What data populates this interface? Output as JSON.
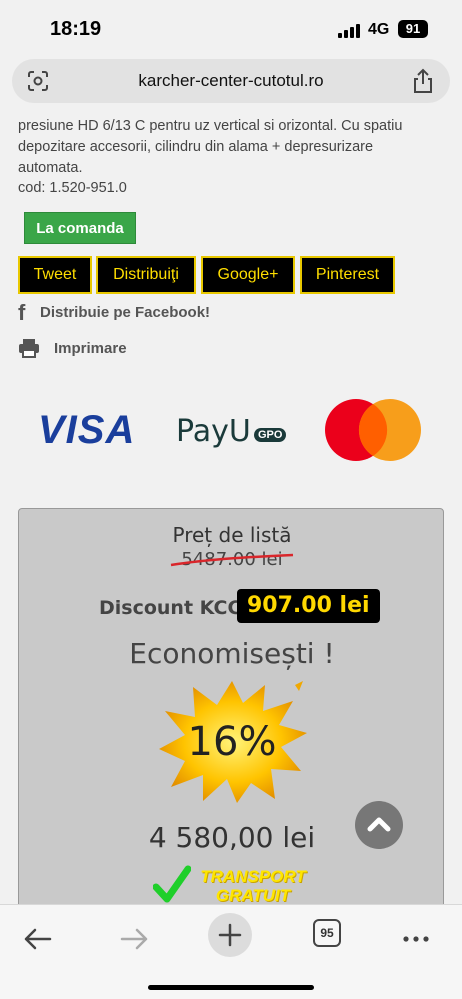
{
  "status": {
    "time": "18:19",
    "network": "4G",
    "battery": "91"
  },
  "browser": {
    "url": "karcher-center-cutotul.ro"
  },
  "product": {
    "description": "presiune HD 6/13 C pentru uz vertical si orizontal. Cu spatiu depozitare accesorii, cilindru din alama + depresurizare automata.",
    "code": "cod: 1.520-951.0",
    "order_label": "La comanda"
  },
  "share": {
    "tweet": "Tweet",
    "distribute": "Distribuiţi",
    "google": "Google+",
    "pinterest": "Pinterest",
    "facebook": "Distribuie pe Facebook!",
    "print": "Imprimare"
  },
  "payments": {
    "visa": "VISA",
    "payu": "PayU",
    "payu_badge": "GPO"
  },
  "price": {
    "list_label": "Preț de listă",
    "list_price": "5487.00 lei",
    "discount_label": "Discount KCC:",
    "discount_value": "907.00 lei",
    "savings_label": "Economisești !",
    "savings_percent": "16%",
    "final_price": "4 580,00 lei",
    "transport_line1": "TRANSPORT",
    "transport_line2": "GRATUIT"
  },
  "toolbar": {
    "tab_count": "95"
  },
  "colors": {
    "accent_green": "#3aa648",
    "share_yellow": "#ffde00",
    "visa_blue": "#1a3e9c",
    "price_box": "#c9c9c9"
  }
}
